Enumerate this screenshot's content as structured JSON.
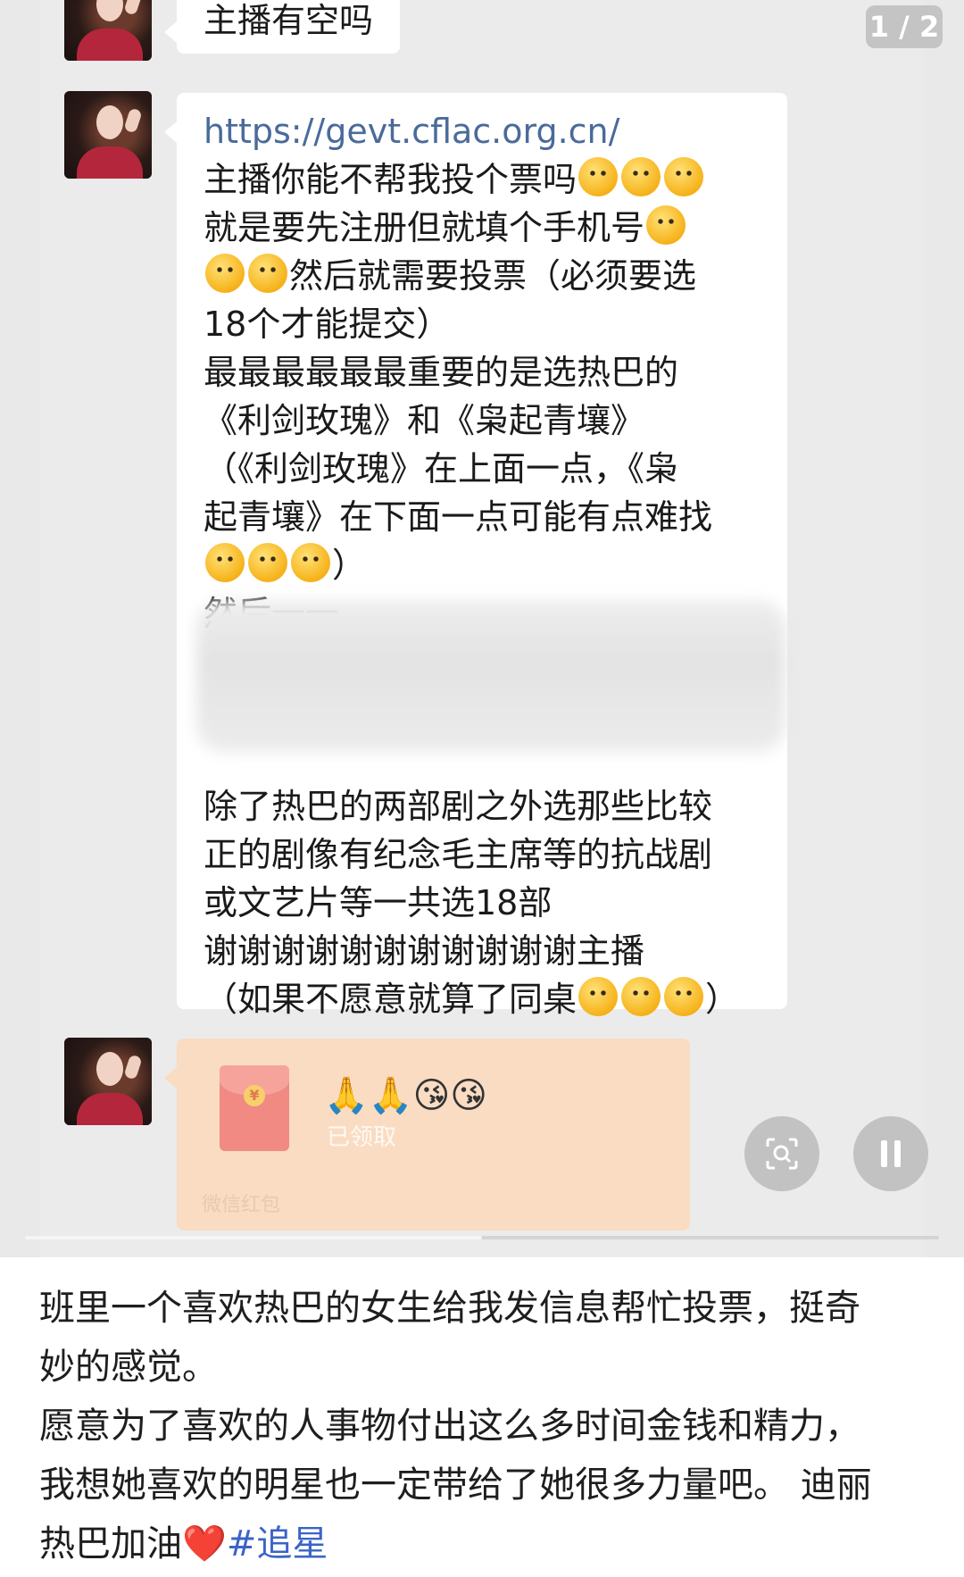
{
  "viewer": {
    "counter": "1 / 2",
    "progress": 0.5
  },
  "messages": {
    "first": "主播有空吗",
    "second_lines": [
      "https://gevt.cflac.org.cn/",
      "主播你能不帮我投个票吗",
      "就是要先注册但就填个手机号",
      "然后就需要投票（必须要选",
      "18个才能提交）",
      "最最最最最最重要的是选热巴的",
      "《利剑玫瑰》和《枭起青壤》",
      "（《利剑玫瑰》在上面一点，《枭",
      "起青壤》在下面一点可能有点难找",
      "）",
      "然后一一",
      "除了热巴的两部剧之外选那些比较",
      "正的剧像有纪念毛主席等的抗战剧",
      "或文艺片等一共选18部",
      "谢谢谢谢谢谢谢谢谢谢谢主播",
      "（如果不愿意就算了同桌",
      "）"
    ],
    "red_packet": {
      "emoji_text": "🙏🙏😘😘",
      "status": "已领取",
      "footer": "微信红包",
      "coin": "¥"
    }
  },
  "controls": {
    "scan_icon": "scan-icon",
    "pause_icon": "pause-icon"
  },
  "caption": {
    "line1": "班里一个喜欢热巴的女生给我发信息帮忙投票，挺奇",
    "line2": "妙的感觉。",
    "line3": "愿意为了喜欢的人事物付出这么多时间金钱和精力，",
    "line4": "我想她喜欢的明星也一定带给了她很多力量吧。 迪丽",
    "line5_text": "热巴加油",
    "heart": "❤️",
    "hashtag": "#追星"
  },
  "colors": {
    "link": "#4a6b9a",
    "hashtag": "#3a64c7",
    "heart": "#e8232f",
    "red_packet_bg": "#f9dcc2"
  }
}
